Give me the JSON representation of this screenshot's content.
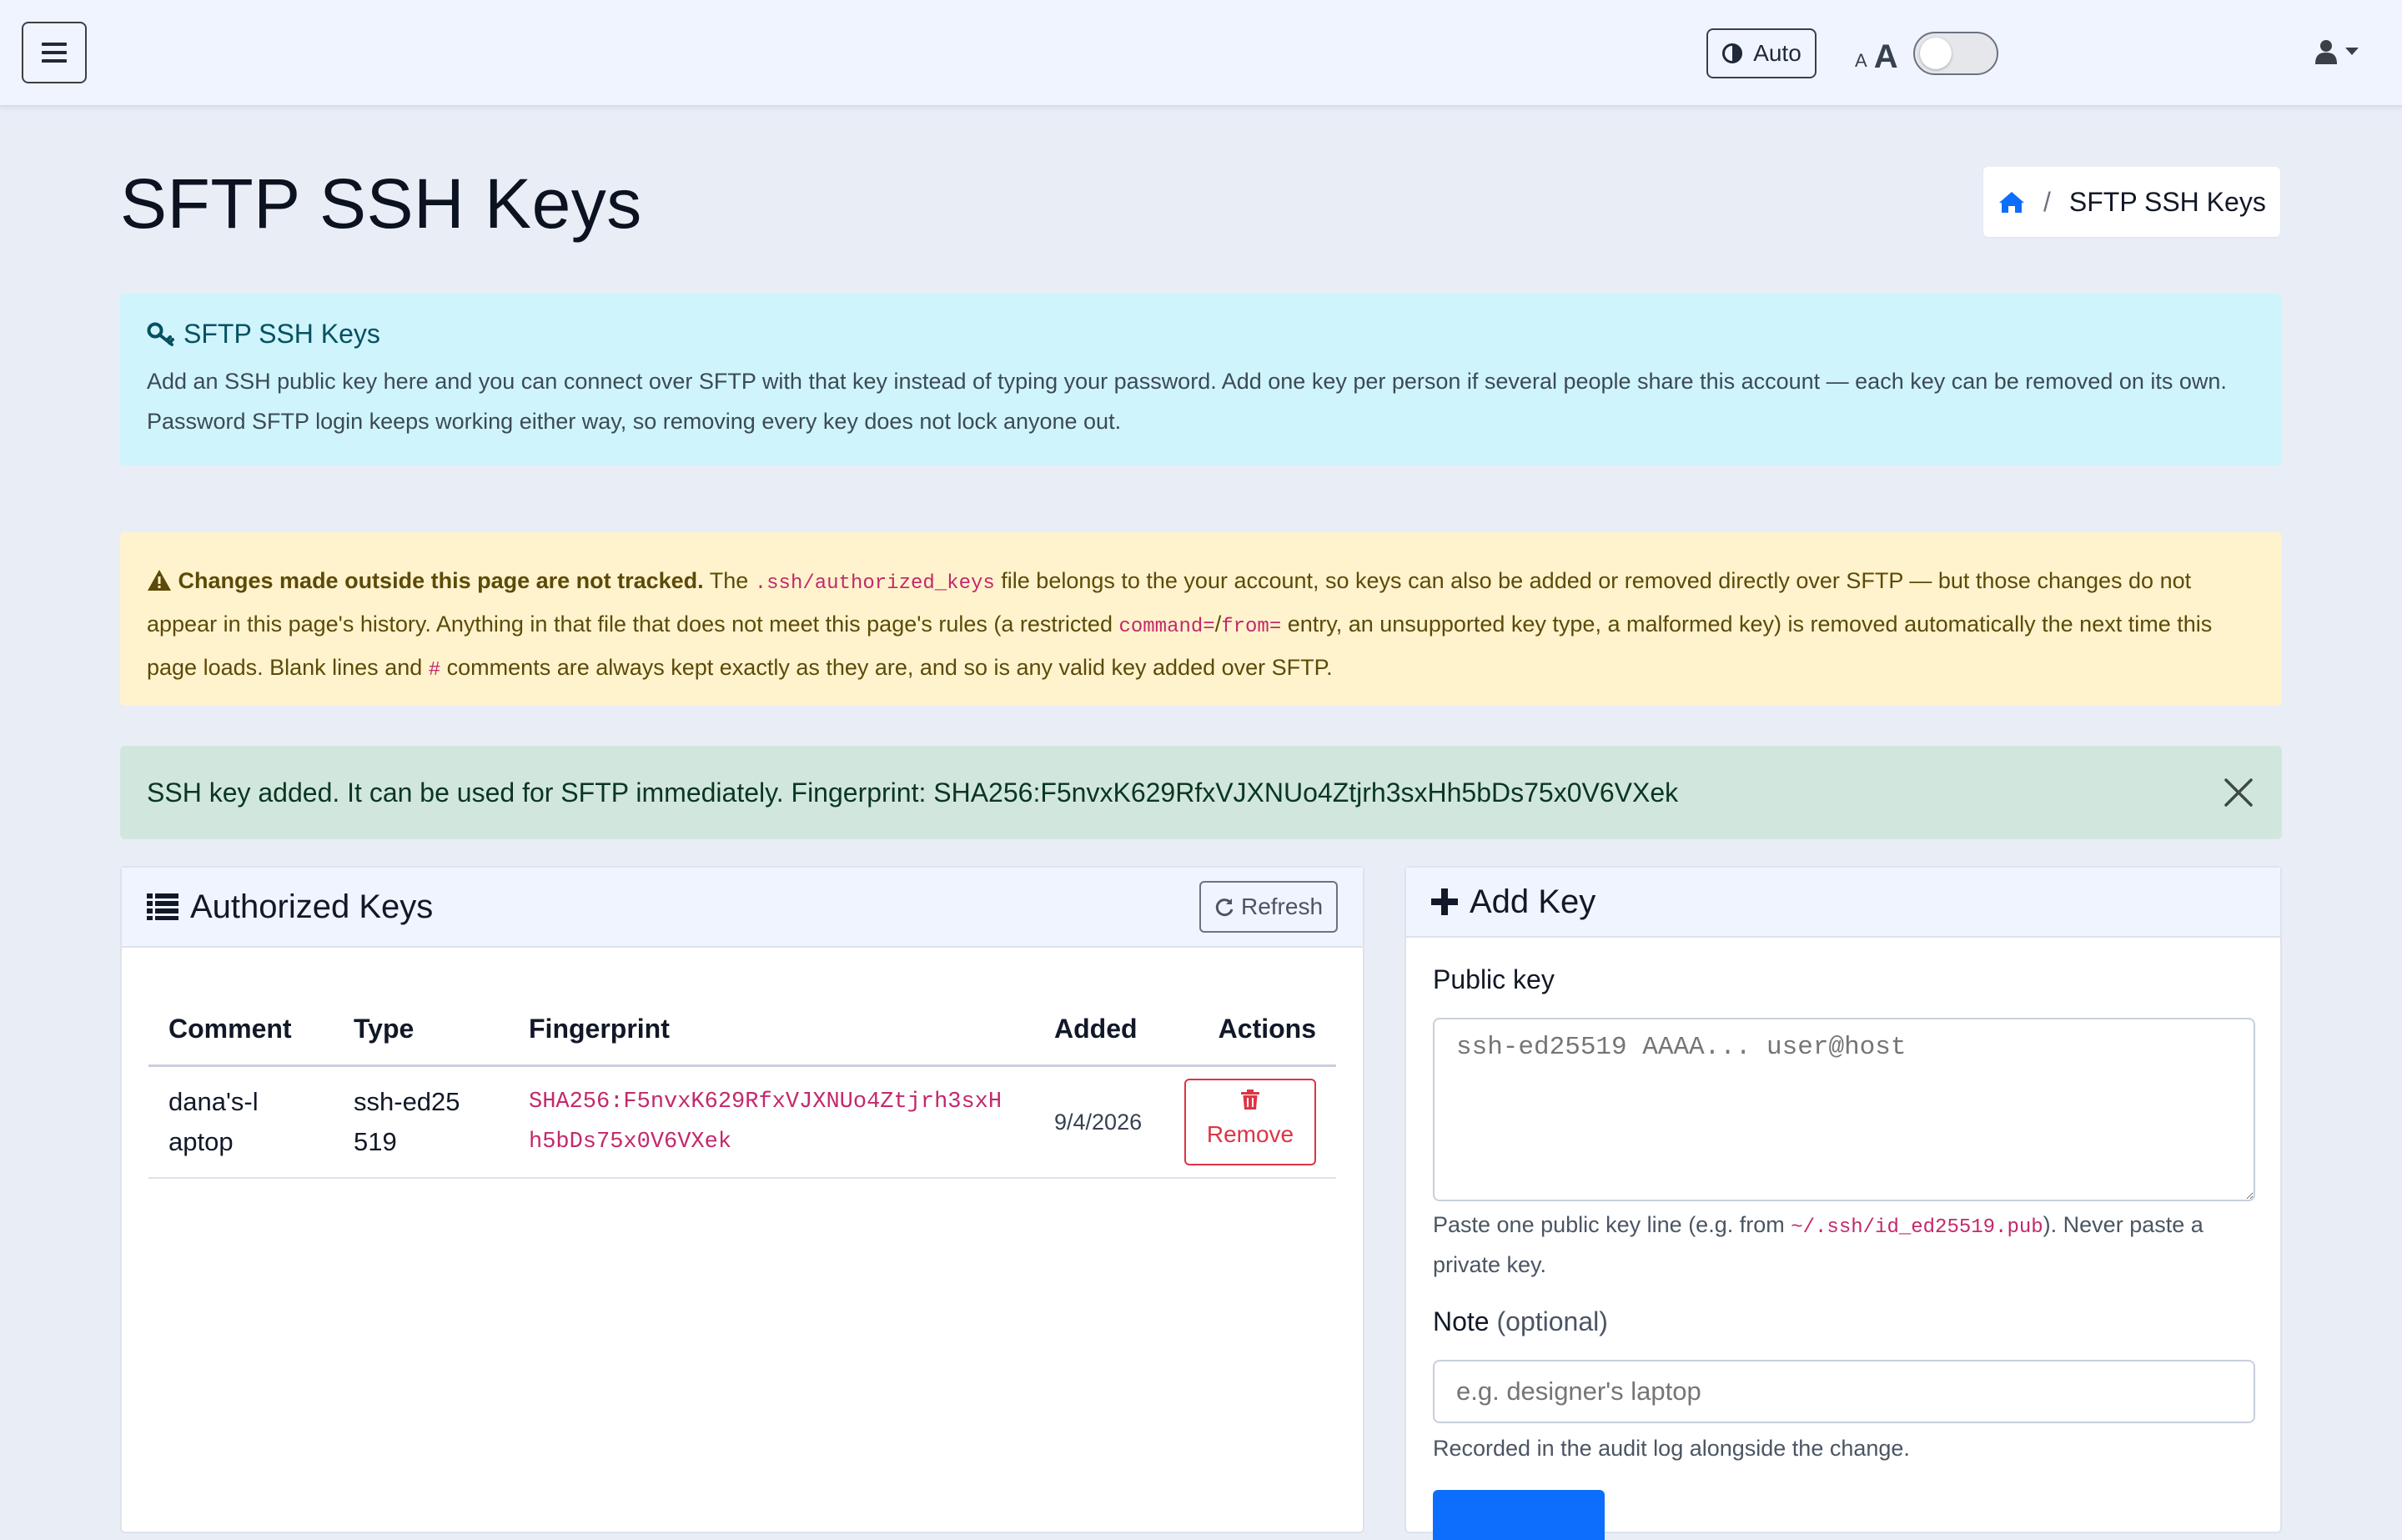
{
  "navbar": {
    "theme_label": "Auto",
    "fontsize_small": "A",
    "fontsize_large": "A",
    "icons": {
      "menu": "hamburger-icon",
      "theme": "contrast-icon",
      "user": "user-icon",
      "caret": "caret-down-icon"
    }
  },
  "header": {
    "title": "SFTP SSH Keys",
    "breadcrumb": {
      "separator": "/",
      "current": "SFTP SSH Keys"
    }
  },
  "info_alert": {
    "title": "SFTP SSH Keys",
    "body": "Add an SSH public key here and you can connect over SFTP with that key instead of typing your password. Add one key per person if several people share this account — each key can be removed on its own. Password SFTP login keeps working either way, so removing every key does not lock anyone out."
  },
  "warning_alert": {
    "strong": "Changes made outside this page are not tracked.",
    "t1": " The ",
    "code1": ".ssh/authorized_keys",
    "t2": " file belongs to the your account, so keys can also be added or removed directly over SFTP — but those changes do not appear in this page's history. Anything in that file that does not meet this page's rules (a restricted ",
    "code2": "command=",
    "t3": "/",
    "code3": "from=",
    "t4": " entry, an unsupported key type, a malformed key) is removed automatically the next time this page loads. Blank lines and ",
    "code4": "#",
    "t5": " comments are always kept exactly as they are, and so is any valid key added over SFTP."
  },
  "success_alert": {
    "text": "SSH key added. It can be used for SFTP immediately. Fingerprint: SHA256:F5nvxK629RfxVJXNUo4Ztjrh3sxHh5bDs75x0V6VXek"
  },
  "keys_card": {
    "title": "Authorized Keys",
    "refresh_label": "Refresh",
    "columns": [
      "Comment",
      "Type",
      "Fingerprint",
      "Added",
      "Actions"
    ],
    "rows": [
      {
        "comment": "dana's-laptop",
        "type": "ssh-ed25519",
        "fingerprint": "SHA256:F5nvxK629RfxVJXNUo4Ztjrh3sxHh5bDs75x0V6VXek",
        "added": "9/4/2026",
        "action_label": "Remove"
      }
    ]
  },
  "add_card": {
    "title": "Add Key",
    "public_key_label": "Public key",
    "public_key_placeholder": "ssh-ed25519 AAAA... user@host",
    "help1_a": "Paste one public key line (e.g. from ",
    "help1_code": "~/.ssh/id_ed25519.pub",
    "help1_b": "). Never paste a private key.",
    "note_label": "Note",
    "note_optional": "(optional)",
    "note_placeholder": "e.g. designer's laptop",
    "help2": "Recorded in the audit log alongside the change."
  },
  "colors": {
    "info_bg": "#cff4fc",
    "warning_bg": "#fff3cd",
    "success_bg": "#d1e7dd",
    "danger": "#dc3545",
    "primary": "#0d6efd",
    "code": "#c4286b"
  }
}
